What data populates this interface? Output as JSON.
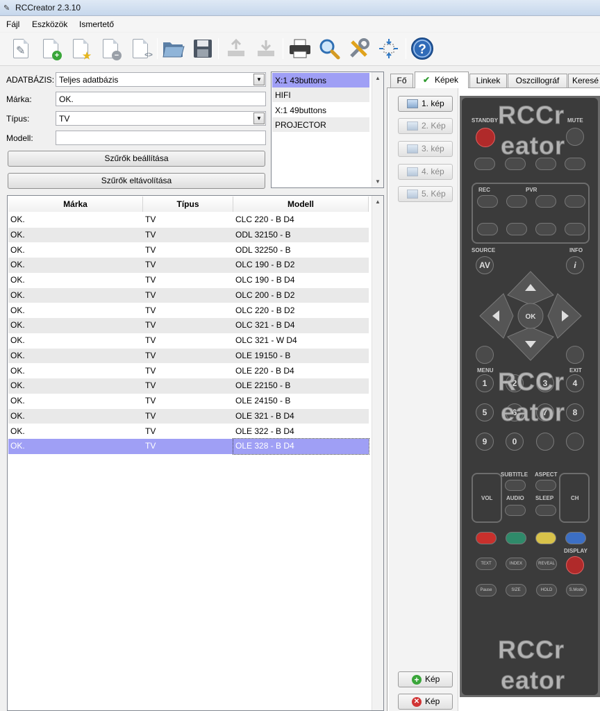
{
  "window": {
    "title": "RCCreator 2.3.10"
  },
  "menu": [
    "Fájl",
    "Eszközök",
    "Ismertető"
  ],
  "toolbar": {
    "icons": [
      "new-icon",
      "add-document-icon",
      "favorite-document-icon",
      "remove-document-icon",
      "code-document-icon",
      "open-folder-icon",
      "save-icon",
      "upload-icon",
      "download-icon",
      "printer-icon",
      "search-icon",
      "settings-icon",
      "fit-icon",
      "help-icon"
    ]
  },
  "filters": {
    "database_label": "ADATBÁZIS:",
    "database_value": "Teljes adatbázis",
    "brand_label": "Márka:",
    "brand_value": "OK.",
    "type_label": "Típus:",
    "type_value": "TV",
    "model_label": "Modell:",
    "model_value": "",
    "apply_label": "Szűrők beállítása",
    "clear_label": "Szűrők eltávolítása"
  },
  "remote_list": [
    "X:1 43buttons",
    "HIFI",
    "X:1 49buttons",
    "PROJECTOR"
  ],
  "table": {
    "headers": [
      "Márka",
      "Típus",
      "Modell"
    ],
    "rows": [
      [
        "OK.",
        "TV",
        "CLC 220 - B D4"
      ],
      [
        "OK.",
        "TV",
        "ODL 32150 - B"
      ],
      [
        "OK.",
        "TV",
        "ODL 32250 - B"
      ],
      [
        "OK.",
        "TV",
        "OLC 190 - B D2"
      ],
      [
        "OK.",
        "TV",
        "OLC 190 - B D4"
      ],
      [
        "OK.",
        "TV",
        "OLC 200 - B D2"
      ],
      [
        "OK.",
        "TV",
        "OLC 220 - B D2"
      ],
      [
        "OK.",
        "TV",
        "OLC 321 - B D4"
      ],
      [
        "OK.",
        "TV",
        "OLC 321 - W D4"
      ],
      [
        "OK.",
        "TV",
        "OLE 19150 - B"
      ],
      [
        "OK.",
        "TV",
        "OLE 220 - B D4"
      ],
      [
        "OK.",
        "TV",
        "OLE 22150 - B"
      ],
      [
        "OK.",
        "TV",
        "OLE 24150 - B"
      ],
      [
        "OK.",
        "TV",
        "OLE 321 - B D4"
      ],
      [
        "OK.",
        "TV",
        "OLE 322 - B D4"
      ],
      [
        "OK.",
        "TV",
        "OLE 328 - B D4"
      ]
    ],
    "selected_index": 15
  },
  "tabs": [
    "Fő",
    "Képek",
    "Linkek",
    "Oszcillográf",
    "Keresé"
  ],
  "active_tab": "Képek",
  "image_buttons": [
    "1. kép",
    "2. Kép",
    "3. kép",
    "4. kép",
    "5. Kép"
  ],
  "add_image_label": "Kép",
  "delete_image_label": "Kép",
  "remote": {
    "watermark": [
      "RCCr",
      "eator"
    ],
    "labels": {
      "standby": "STANDBY",
      "mute": "MUTE",
      "rec": "REC",
      "pvr": "PVR",
      "source": "SOURCE",
      "info": "INFO",
      "menu": "MENU",
      "exit": "EXIT",
      "subtitle": "SUBTITLE",
      "aspect": "ASPECT",
      "vol": "VOL",
      "ch": "CH",
      "audio": "AUDIO",
      "sleep": "SLEEP",
      "display": "DISPLAY",
      "ok": "OK",
      "av": "AV"
    },
    "digits": [
      "1",
      "2",
      "3",
      "4",
      "5",
      "6",
      "7",
      "8",
      "9",
      "0"
    ],
    "bottom_keys": [
      "TEXT",
      "INDEX",
      "REVEAL",
      "Pause",
      "SIZE",
      "HOLD",
      "S.Mode"
    ],
    "color_keys": [
      "#c8302c",
      "#2f8a6a",
      "#d8c24a",
      "#3c6fc4"
    ]
  }
}
